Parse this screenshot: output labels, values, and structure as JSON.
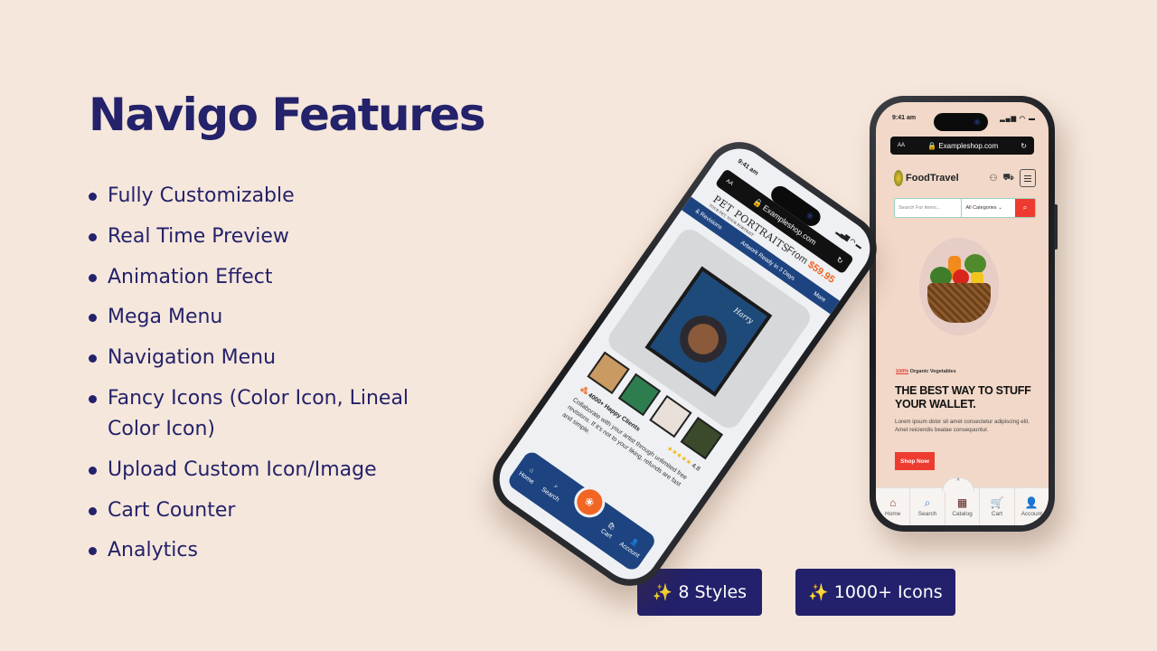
{
  "title": "Navigo Features",
  "features": [
    "Fully Customizable",
    "Real Time Preview",
    "Animation Effect",
    "Mega Menu",
    "Navigation Menu",
    "Fancy Icons (Color Icon, Lineal Color Icon)",
    "Upload Custom Icon/Image",
    "Cart Counter",
    "Analytics"
  ],
  "badges": {
    "styles": {
      "icon": "sparkles-icon",
      "glyph": "✨",
      "label": "8 Styles"
    },
    "icons": {
      "icon": "sparkles-icon",
      "glyph": "✨",
      "label": "1000+ Icons"
    }
  },
  "colors": {
    "background": "#f6e7dc",
    "primary": "#23226a",
    "accent_orange": "#f26522",
    "accent_red": "#ee3b2f",
    "pet_blue": "#1d4480"
  },
  "food_phone": {
    "time": "9:41 am",
    "signal": "▂▄▆ ◠ ▬",
    "url_aa": "AA",
    "url": "🔒 Exampleshop.com",
    "reload": "↻",
    "brand": "FoodTravel",
    "search_placeholder": "Search For items...",
    "category": "All Categories ⌄",
    "search_icon": "⌕",
    "tag_highlight": "100%",
    "tag_text": " Organic Vegetables",
    "headline": "THE BEST WAY TO STUFF YOUR WALLET.",
    "body": "Lorem ipsum dolor sit amet consectetur adipiscing elit. Amet reiciendis beatae consequuntur.",
    "cta": "Shop Now",
    "nav_bump": "^",
    "nav": [
      {
        "icon": "home-icon",
        "glyph": "⌂",
        "label": "Home"
      },
      {
        "icon": "search-icon",
        "glyph": "⌕",
        "label": "Search"
      },
      {
        "icon": "catalog-icon",
        "glyph": "▦",
        "label": "Catalog"
      },
      {
        "icon": "cart-icon",
        "glyph": "🛒",
        "label": "Cart"
      },
      {
        "icon": "account-icon",
        "glyph": "👤",
        "label": "Account"
      }
    ]
  },
  "pet_phone": {
    "time": "9:41 am",
    "url_aa": "AA",
    "url": "🔒 Exampleshop.com",
    "reload": "↻",
    "logo": "PET PORTRAITS",
    "logo_sub": "YOUR PET, YOUR PORTRAIT",
    "price_label": "From ",
    "price": "$59.95",
    "banner": [
      "& Revisions",
      "Artwork Ready in 3 Days",
      "More"
    ],
    "portrait_name": "Harry",
    "clients": "4000+ Happy Clients",
    "stars": "★★★★★",
    "rating": "4.8",
    "description": "Collaborate with your artist through unlimited free revisions. If it's not to your liking, refunds are fast and simple.",
    "nav": [
      {
        "icon": "home-icon",
        "glyph": "⌂",
        "label": "Home"
      },
      {
        "icon": "search-icon",
        "glyph": "⌕",
        "label": "Search"
      },
      {
        "icon": "cart-icon",
        "glyph": "🛍",
        "label": "Cart"
      },
      {
        "icon": "account-icon",
        "glyph": "👤",
        "label": "Account"
      }
    ],
    "center_glyph": "❀"
  }
}
